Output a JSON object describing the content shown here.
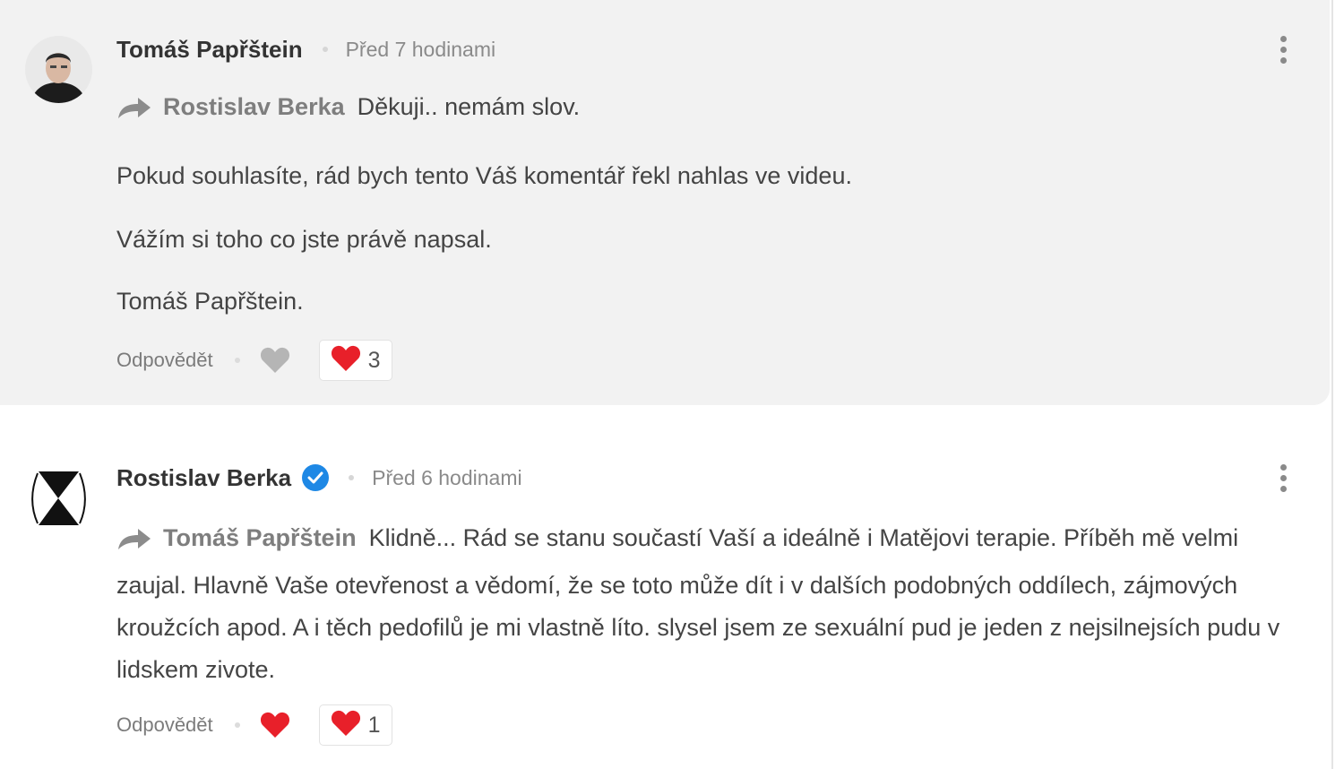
{
  "comments": [
    {
      "author": "Tomáš Papřštein",
      "time": "Před 7 hodinami",
      "reply_to": "Rostislav Berka",
      "paragraphs": [
        "Děkuji.. nemám slov.",
        "Pokud souhlasíte, rád bych tento Váš komentář řekl nahlas ve videu.",
        "Vážím si toho co jste právě napsal.",
        "Tomáš Papřštein."
      ],
      "reply_label": "Odpovědět",
      "like_count": "3",
      "liked": false
    },
    {
      "author": "Rostislav Berka",
      "verified": true,
      "time": "Před 6 hodinami",
      "reply_to": "Tomáš Papřštein",
      "text": "Klidně... Rád se stanu součastí Vaší a ideálně i Matějovi terapie. Příběh mě velmi zaujal. Hlavně Vaše otevřenost a vědomí, že se toto může dít i v dalších podobných oddílech, zájmových kroužcích apod. A i těch pedofilů je mi vlastně líto. slysel jsem ze sexuální pud je jeden z nejsilnejsích pudu v lidskem zivote.",
      "reply_label": "Odpovědět",
      "like_count": "1",
      "liked": true
    }
  ],
  "colors": {
    "highlight_bg": "#f2f2f2",
    "heart_red": "#e8202a",
    "heart_gray": "#b5b5b5",
    "verified_blue": "#1e88e5"
  }
}
